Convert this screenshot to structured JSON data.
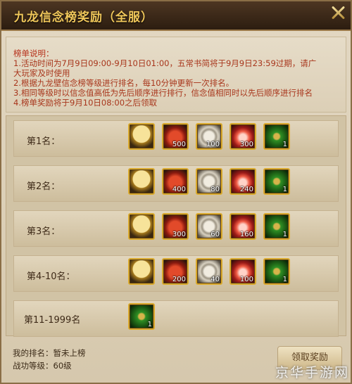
{
  "window": {
    "title": "九龙信念榜奖励（全服）"
  },
  "rules": {
    "title": "榜单说明：",
    "lines": [
      "1.活动时间为7月9日09:00-9月10日01:00，五常书简将于9月9日23:59过期，请广",
      "大玩家及时使用",
      "2.根据九龙壁信念榜等级进行排名，每10分钟更新一次排名。",
      "3.相同等级时以信念值高低为先后顺序进行排行，信念值相同时以先后顺序进行排名",
      "4.榜单奖励将于9月10日08:00之后领取"
    ]
  },
  "tiers": [
    {
      "rank": "第1名：",
      "items": [
        {
          "icon": "gold-medal-icon",
          "count": ""
        },
        {
          "icon": "red-book-icon",
          "count": "500"
        },
        {
          "icon": "shell-icon",
          "count": "100"
        },
        {
          "icon": "red-lotus-icon",
          "count": "300"
        },
        {
          "icon": "green-chest-icon",
          "count": "1"
        }
      ]
    },
    {
      "rank": "第2名：",
      "items": [
        {
          "icon": "gold-medal-icon",
          "count": ""
        },
        {
          "icon": "red-book-icon",
          "count": "400"
        },
        {
          "icon": "shell-icon",
          "count": "80"
        },
        {
          "icon": "red-lotus-icon",
          "count": "240"
        },
        {
          "icon": "green-chest-icon",
          "count": "1"
        }
      ]
    },
    {
      "rank": "第3名：",
      "items": [
        {
          "icon": "gold-medal-icon",
          "count": ""
        },
        {
          "icon": "red-book-icon",
          "count": "300"
        },
        {
          "icon": "shell-icon",
          "count": "60"
        },
        {
          "icon": "red-lotus-icon",
          "count": "160"
        },
        {
          "icon": "green-chest-icon",
          "count": "1"
        }
      ]
    },
    {
      "rank": "第4-10名：",
      "items": [
        {
          "icon": "gold-medal-icon",
          "count": ""
        },
        {
          "icon": "red-book-icon",
          "count": "200"
        },
        {
          "icon": "shell-icon",
          "count": "40"
        },
        {
          "icon": "red-lotus-icon",
          "count": "100"
        },
        {
          "icon": "green-chest-icon",
          "count": "1"
        }
      ]
    },
    {
      "rank": "第11-1999名",
      "items": [
        {
          "icon": "green-chest-icon",
          "count": "1"
        }
      ]
    }
  ],
  "footer": {
    "my_rank": "我的排名：暂未上榜",
    "power_level": "战功等级：60级",
    "claim_button": "领取奖励"
  },
  "watermark": "京华手游网"
}
